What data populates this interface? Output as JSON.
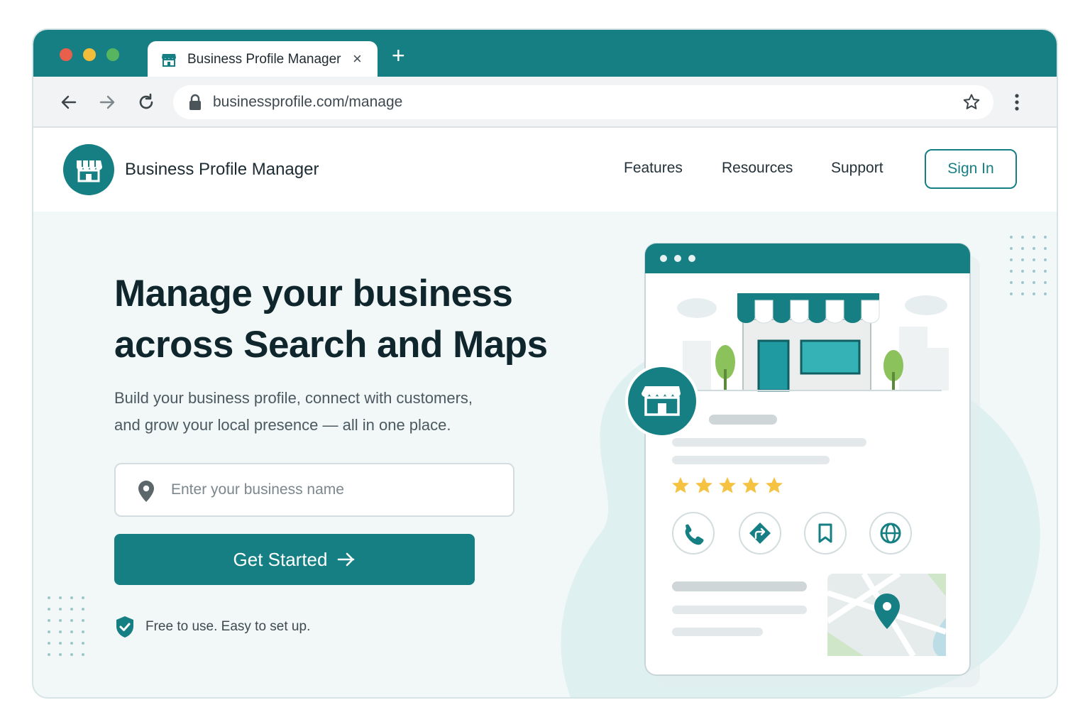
{
  "browser": {
    "tab_title": "Business Profile Manager",
    "tab_close": "×",
    "new_tab": "+",
    "url": "businessprofile.com/manage",
    "colors": {
      "chrome": "#167f84",
      "dot_red": "#e8604c",
      "dot_yellow": "#f2bd3a",
      "dot_green": "#56b55e"
    }
  },
  "header": {
    "brand": "Business Profile Manager",
    "nav": [
      "Features",
      "Resources",
      "Support"
    ],
    "signin_label": "Sign In"
  },
  "hero": {
    "title_line1": "Manage your business",
    "title_line2": "across Search and Maps",
    "subtitle_line1": "Build your business profile, connect with customers,",
    "subtitle_line2": "and grow your local presence — all in one place.",
    "search_placeholder": "Enter your business name",
    "cta_label": "Get Started",
    "trust_text": "Free to use. Easy to set up."
  },
  "illustration": {
    "rating_stars": 5,
    "action_icons": [
      "phone-icon",
      "directions-icon",
      "bookmark-icon",
      "globe-icon"
    ],
    "accent_color": "#167f84",
    "star_color": "#f5c242"
  }
}
